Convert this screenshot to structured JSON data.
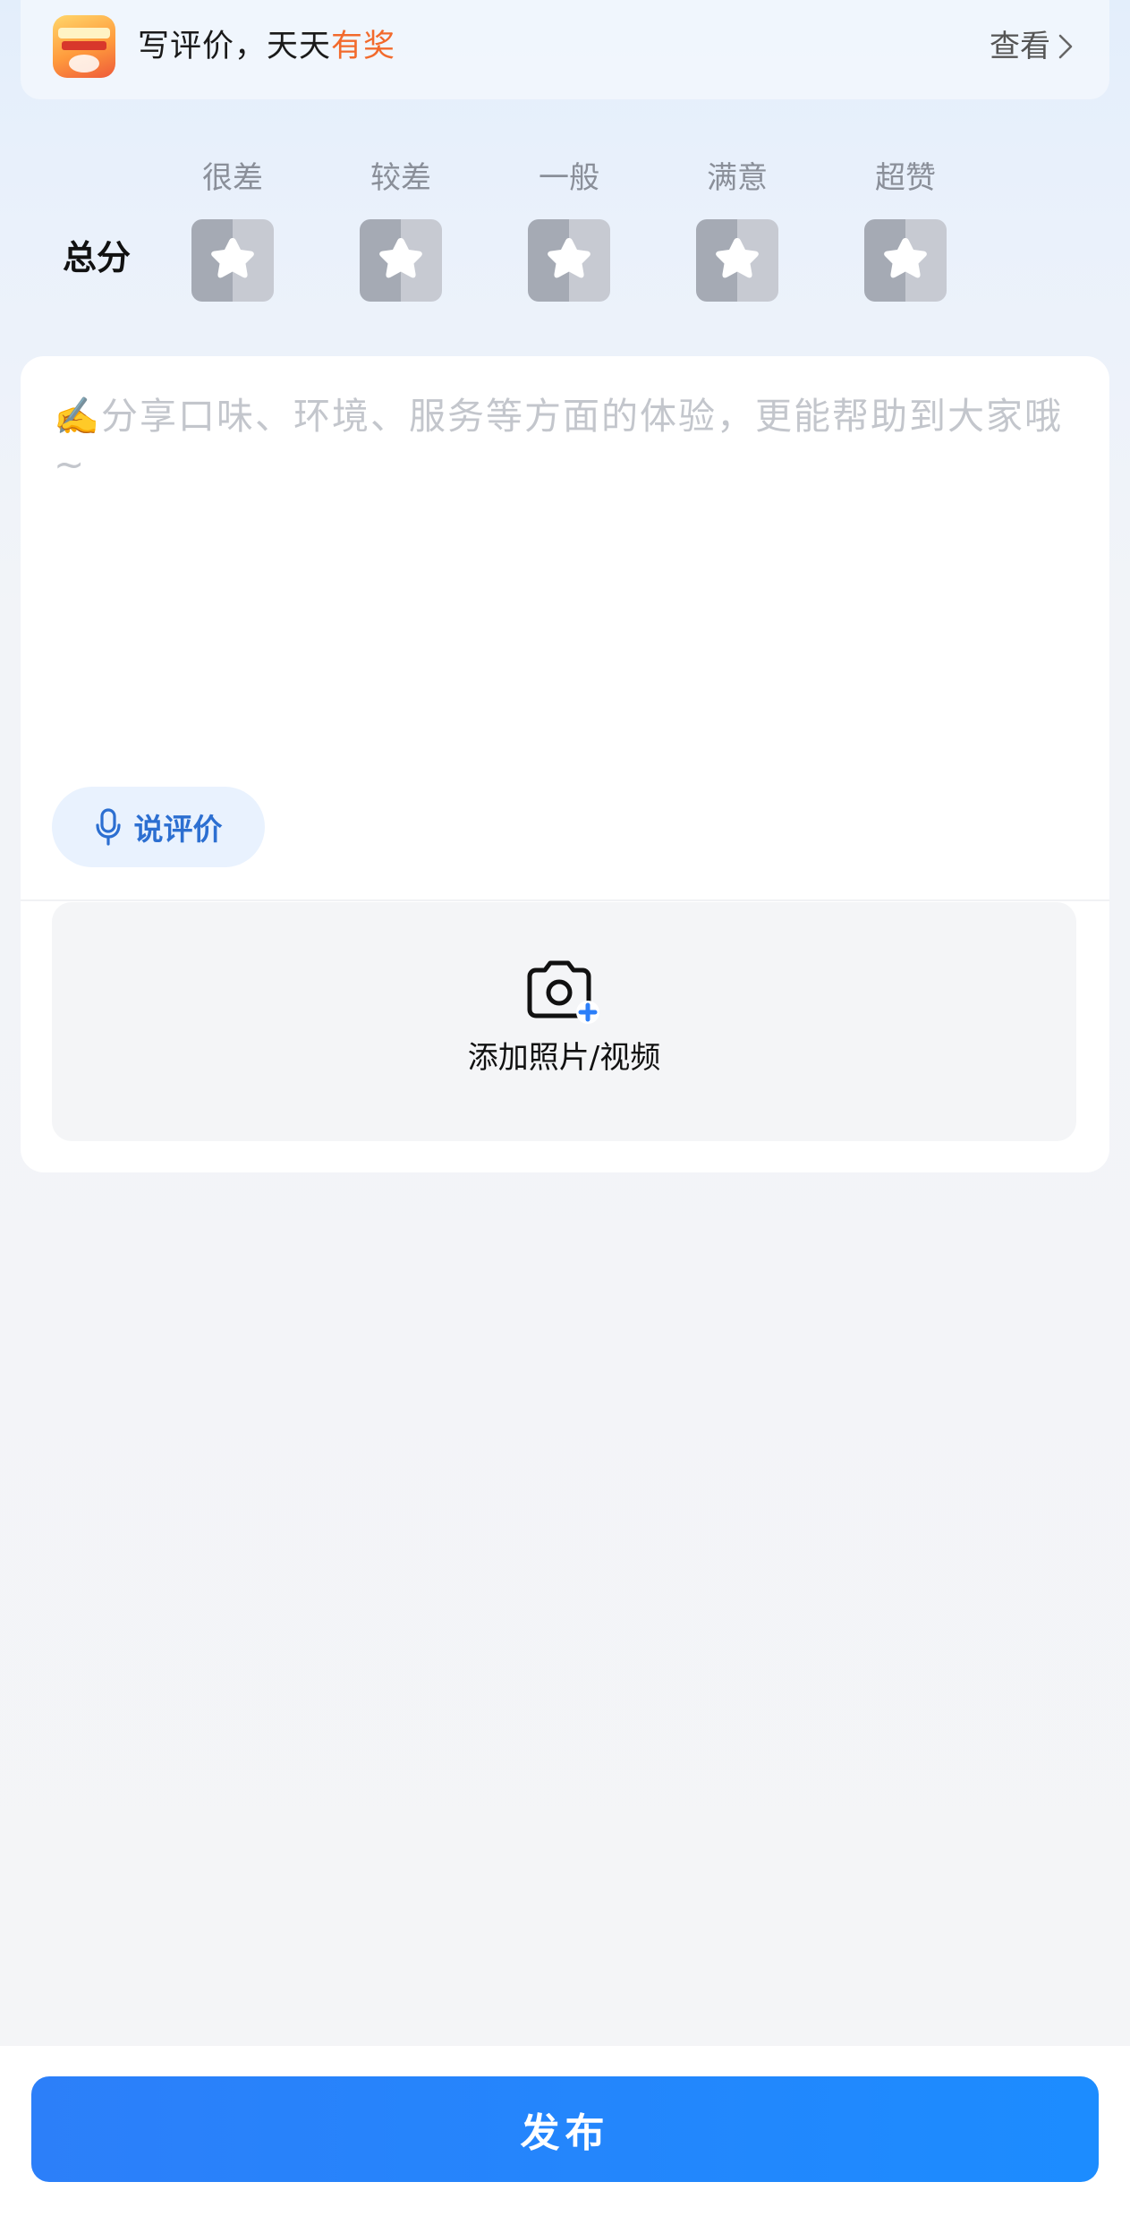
{
  "banner": {
    "text_main": "写评价，天天",
    "text_highlight": "有奖",
    "view_label": "查看",
    "logo_icon": "promo-logo-icon",
    "highlight_color": "#f26a2c"
  },
  "rating": {
    "label": "总分",
    "levels": [
      {
        "label": "很差"
      },
      {
        "label": "较差"
      },
      {
        "label": "一般"
      },
      {
        "label": "满意"
      },
      {
        "label": "超赞"
      }
    ],
    "selected_stars": 0,
    "star_icon": "star-icon"
  },
  "review": {
    "placeholder": "✍️分享口味、环境、服务等方面的体验，更能帮助到大家哦~",
    "value": ""
  },
  "voice": {
    "label": "说评价",
    "icon": "microphone-icon"
  },
  "upload": {
    "label": "添加照片/视频",
    "icon": "camera-plus-icon"
  },
  "publish": {
    "label": "发布",
    "color": "#2c7ff9"
  }
}
